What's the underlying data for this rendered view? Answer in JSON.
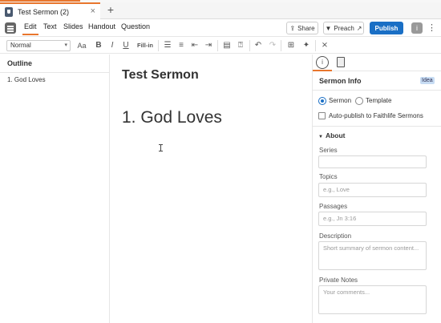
{
  "window": {
    "tab_title": "Test Sermon (2)",
    "tab_close": "×",
    "tab_add": "+"
  },
  "menu": {
    "items": [
      "Edit",
      "Text",
      "Slides",
      "Handout",
      "Question"
    ],
    "share_label": "Share",
    "preach_label": "Preach",
    "publish_label": "Publish",
    "info_label": "i",
    "more_label": "⋮"
  },
  "toolbar": {
    "style_value": "Normal",
    "font_size_icon": "Aa",
    "bold": "B",
    "italic": "I",
    "underline": "U",
    "fill_in": "Fill-in"
  },
  "outline": {
    "title": "Outline",
    "items": [
      "1. God Loves"
    ]
  },
  "document": {
    "title": "Test Sermon",
    "heading": "1. God Loves"
  },
  "sidebar": {
    "title": "Sermon Info",
    "badge": "Idea",
    "type_options": [
      "Sermon",
      "Template"
    ],
    "selected_type": "Sermon",
    "auto_publish_label": "Auto-publish to Faithlife Sermons",
    "auto_publish_checked": false,
    "about_label": "About",
    "fields": [
      {
        "label": "Series",
        "placeholder": ""
      },
      {
        "label": "Topics",
        "placeholder": "e.g., Love"
      },
      {
        "label": "Passages",
        "placeholder": "e.g., Jn 3:16"
      },
      {
        "label": "Description",
        "placeholder": "Short summary of sermon content..."
      },
      {
        "label": "Private Notes",
        "placeholder": "Your comments..."
      }
    ]
  },
  "colors": {
    "accent": "#e8762d",
    "primary": "#1a6fc5",
    "badge_bg": "#c7dcf3"
  }
}
